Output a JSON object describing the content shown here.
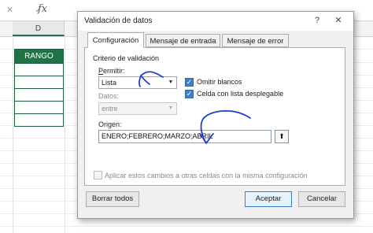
{
  "sheet": {
    "formula_tools": "✕ ✓",
    "fx_label": "fx",
    "column_label": "D",
    "range_header": "RANGO",
    "range_rows": 5
  },
  "dialog": {
    "title": "Validación de datos",
    "help_label": "?",
    "close_label": "✕",
    "tabs": [
      {
        "label": "Configuración",
        "active": true
      },
      {
        "label": "Mensaje de entrada",
        "active": false
      },
      {
        "label": "Mensaje de error",
        "active": false
      }
    ],
    "criteria_title": "Criterio de validación",
    "allow_label": "Permitir:",
    "allow_value": "Lista",
    "data_label": "Datos:",
    "data_value": "entre",
    "ignore_blank_label": "Omitir blancos",
    "ignore_blank_checked": true,
    "dropdown_label": "Celda con lista desplegable",
    "dropdown_checked": true,
    "source_label": "Origen:",
    "source_value": "ENERO;FEBRERO;MARZO;ABRIL",
    "apply_all_label": "Aplicar estos cambios a otras celdas con la misma configuración",
    "apply_all_checked": false,
    "clear_all_label": "Borrar todos",
    "ok_label": "Aceptar",
    "cancel_label": "Cancelar"
  },
  "colors": {
    "excel_green": "#217346",
    "checkbox_blue": "#3c7fd1",
    "ink_blue": "#1c3fd6"
  }
}
